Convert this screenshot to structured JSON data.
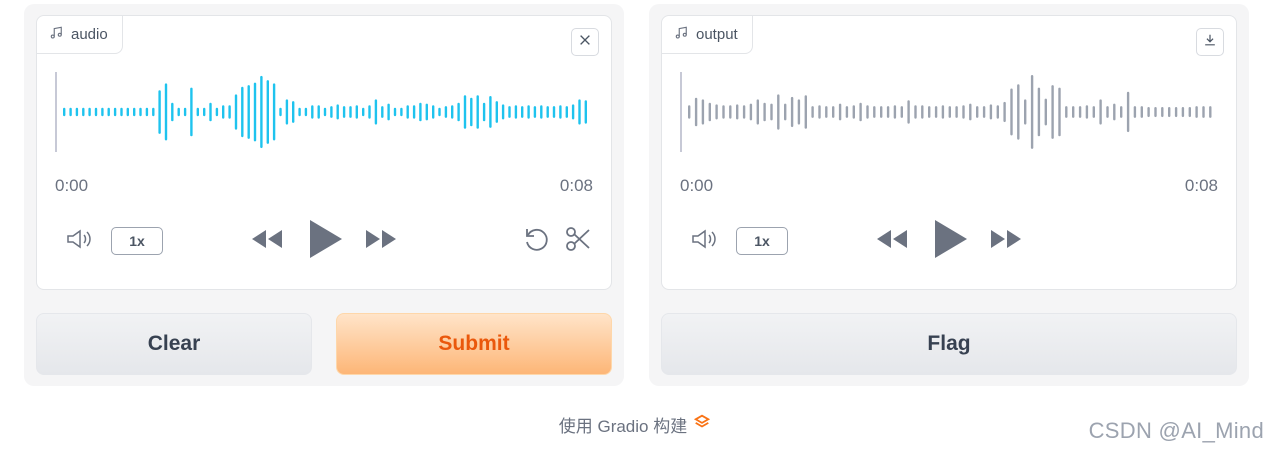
{
  "colors": {
    "accent_wave": "#1ec3ee",
    "output_wave": "#9ca3af",
    "primary_text": "#ea580c"
  },
  "input_audio": {
    "label": "audio",
    "current_time": "0:00",
    "duration": "0:08",
    "speed": "1x",
    "icons": [
      "music-note-icon",
      "close-icon",
      "volume-icon",
      "rewind-icon",
      "play-icon",
      "fast-forward-icon",
      "undo-icon",
      "scissors-icon"
    ],
    "waveform": [
      0.1,
      0.1,
      0.1,
      0.1,
      0.1,
      0.1,
      0.1,
      0.1,
      0.1,
      0.1,
      0.1,
      0.1,
      0.1,
      0.1,
      0.1,
      0.52,
      0.68,
      0.22,
      0.1,
      0.1,
      0.58,
      0.1,
      0.1,
      0.22,
      0.1,
      0.16,
      0.16,
      0.42,
      0.6,
      0.64,
      0.7,
      0.86,
      0.76,
      0.68,
      0.1,
      0.3,
      0.26,
      0.1,
      0.1,
      0.16,
      0.16,
      0.1,
      0.14,
      0.18,
      0.14,
      0.14,
      0.16,
      0.1,
      0.16,
      0.3,
      0.14,
      0.2,
      0.1,
      0.1,
      0.16,
      0.16,
      0.22,
      0.2,
      0.16,
      0.1,
      0.14,
      0.16,
      0.22,
      0.4,
      0.34,
      0.4,
      0.22,
      0.38,
      0.26,
      0.18,
      0.14,
      0.16,
      0.14,
      0.16,
      0.14,
      0.16,
      0.14,
      0.14,
      0.16,
      0.14,
      0.18,
      0.3,
      0.28
    ]
  },
  "output_audio": {
    "label": "output",
    "current_time": "0:00",
    "duration": "0:08",
    "speed": "1x",
    "icons": [
      "music-note-icon",
      "download-icon",
      "volume-icon",
      "rewind-icon",
      "play-icon",
      "fast-forward-icon"
    ],
    "waveform": [
      0.16,
      0.34,
      0.3,
      0.22,
      0.18,
      0.16,
      0.16,
      0.18,
      0.16,
      0.2,
      0.3,
      0.22,
      0.2,
      0.42,
      0.2,
      0.36,
      0.3,
      0.4,
      0.14,
      0.16,
      0.14,
      0.14,
      0.2,
      0.14,
      0.16,
      0.22,
      0.16,
      0.14,
      0.14,
      0.14,
      0.16,
      0.14,
      0.28,
      0.16,
      0.16,
      0.14,
      0.14,
      0.16,
      0.14,
      0.14,
      0.16,
      0.2,
      0.14,
      0.14,
      0.18,
      0.16,
      0.24,
      0.56,
      0.66,
      0.3,
      0.88,
      0.58,
      0.32,
      0.64,
      0.58,
      0.14,
      0.14,
      0.14,
      0.16,
      0.14,
      0.3,
      0.14,
      0.2,
      0.14,
      0.48,
      0.14,
      0.14,
      0.12,
      0.12,
      0.12,
      0.12,
      0.12,
      0.12,
      0.12,
      0.14,
      0.14,
      0.14
    ]
  },
  "buttons": {
    "clear": "Clear",
    "submit": "Submit",
    "flag": "Flag"
  },
  "footer": {
    "text": "使用 Gradio 构建"
  },
  "watermark": "CSDN @AI_Mind"
}
